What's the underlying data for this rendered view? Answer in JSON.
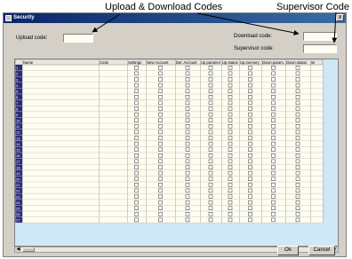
{
  "annotations": {
    "upload_download": "Upload & Download Codes",
    "supervisor": "Supervisor Code"
  },
  "window": {
    "title": "Security",
    "close_glyph": "x"
  },
  "form": {
    "upload_label": "Upload code:",
    "upload_value": "",
    "download_label": "Download code:",
    "download_value": "",
    "supervisor_label": "Supervisor code:",
    "supervisor_value": ""
  },
  "grid": {
    "columns": [
      "Name",
      "Code",
      "Settings",
      "New Account",
      "Del. Account",
      "Up.paramet",
      "Up.status",
      "Up.memory",
      "Down.param.",
      "Down.status",
      "W"
    ],
    "rows": [
      "1",
      "2",
      "3",
      "4",
      "5",
      "6",
      "7",
      "8",
      "9",
      "10",
      "11",
      "12",
      "13",
      "14",
      "15",
      "16",
      "17",
      "18",
      "19",
      "20",
      "21",
      "22",
      "23",
      "24",
      "25",
      "26",
      "27"
    ]
  },
  "buttons": {
    "ok": "Ok",
    "cancel": "Cancel"
  },
  "colors": {
    "cell_bg": "#fefdf0",
    "row_header_bg": "#2b2b7a",
    "grid_bg": "#cfe8f5"
  }
}
